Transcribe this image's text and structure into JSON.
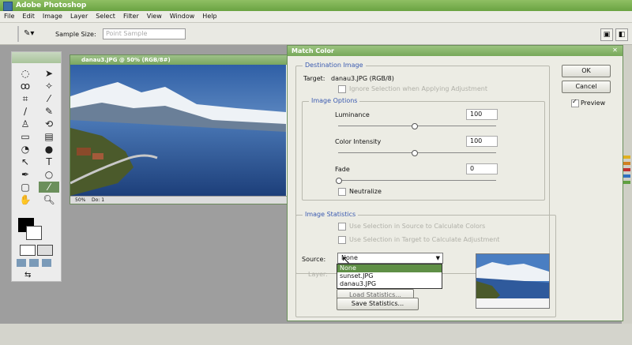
{
  "app": {
    "title": "Adobe Photoshop"
  },
  "menu": [
    "File",
    "Edit",
    "Image",
    "Layer",
    "Select",
    "Filter",
    "View",
    "Window",
    "Help"
  ],
  "options_bar": {
    "sample_size_label": "Sample Size:",
    "sample_size_value": "Point Sample"
  },
  "document": {
    "title": "danau3.JPG @ 50% (RGB/8#)",
    "zoom": "50%",
    "status": "Do: 1"
  },
  "dialog": {
    "title": "Match Color",
    "destination": {
      "legend": "Destination Image",
      "target_label": "Target:",
      "target_value": "danau3.JPG (RGB/8)",
      "ignore_selection": "Ignore Selection when Applying Adjustment"
    },
    "image_options": {
      "legend": "Image Options",
      "luminance_label": "Luminance",
      "luminance_value": "100",
      "intensity_label": "Color Intensity",
      "intensity_value": "100",
      "fade_label": "Fade",
      "fade_value": "0",
      "neutralize_label": "Neutralize"
    },
    "image_statistics": {
      "legend": "Image Statistics",
      "use_source": "Use Selection in Source to Calculate Colors",
      "use_target": "Use Selection in Target to Calculate Adjustment",
      "source_label": "Source:",
      "source_value": "None",
      "layer_label": "Layer:",
      "source_options": [
        "None",
        "sunset.JPG",
        "danau3.JPG"
      ],
      "load_label": "Load Statistics...",
      "save_label": "Save Statistics..."
    },
    "buttons": {
      "ok": "OK",
      "cancel": "Cancel",
      "preview": "Preview"
    }
  }
}
